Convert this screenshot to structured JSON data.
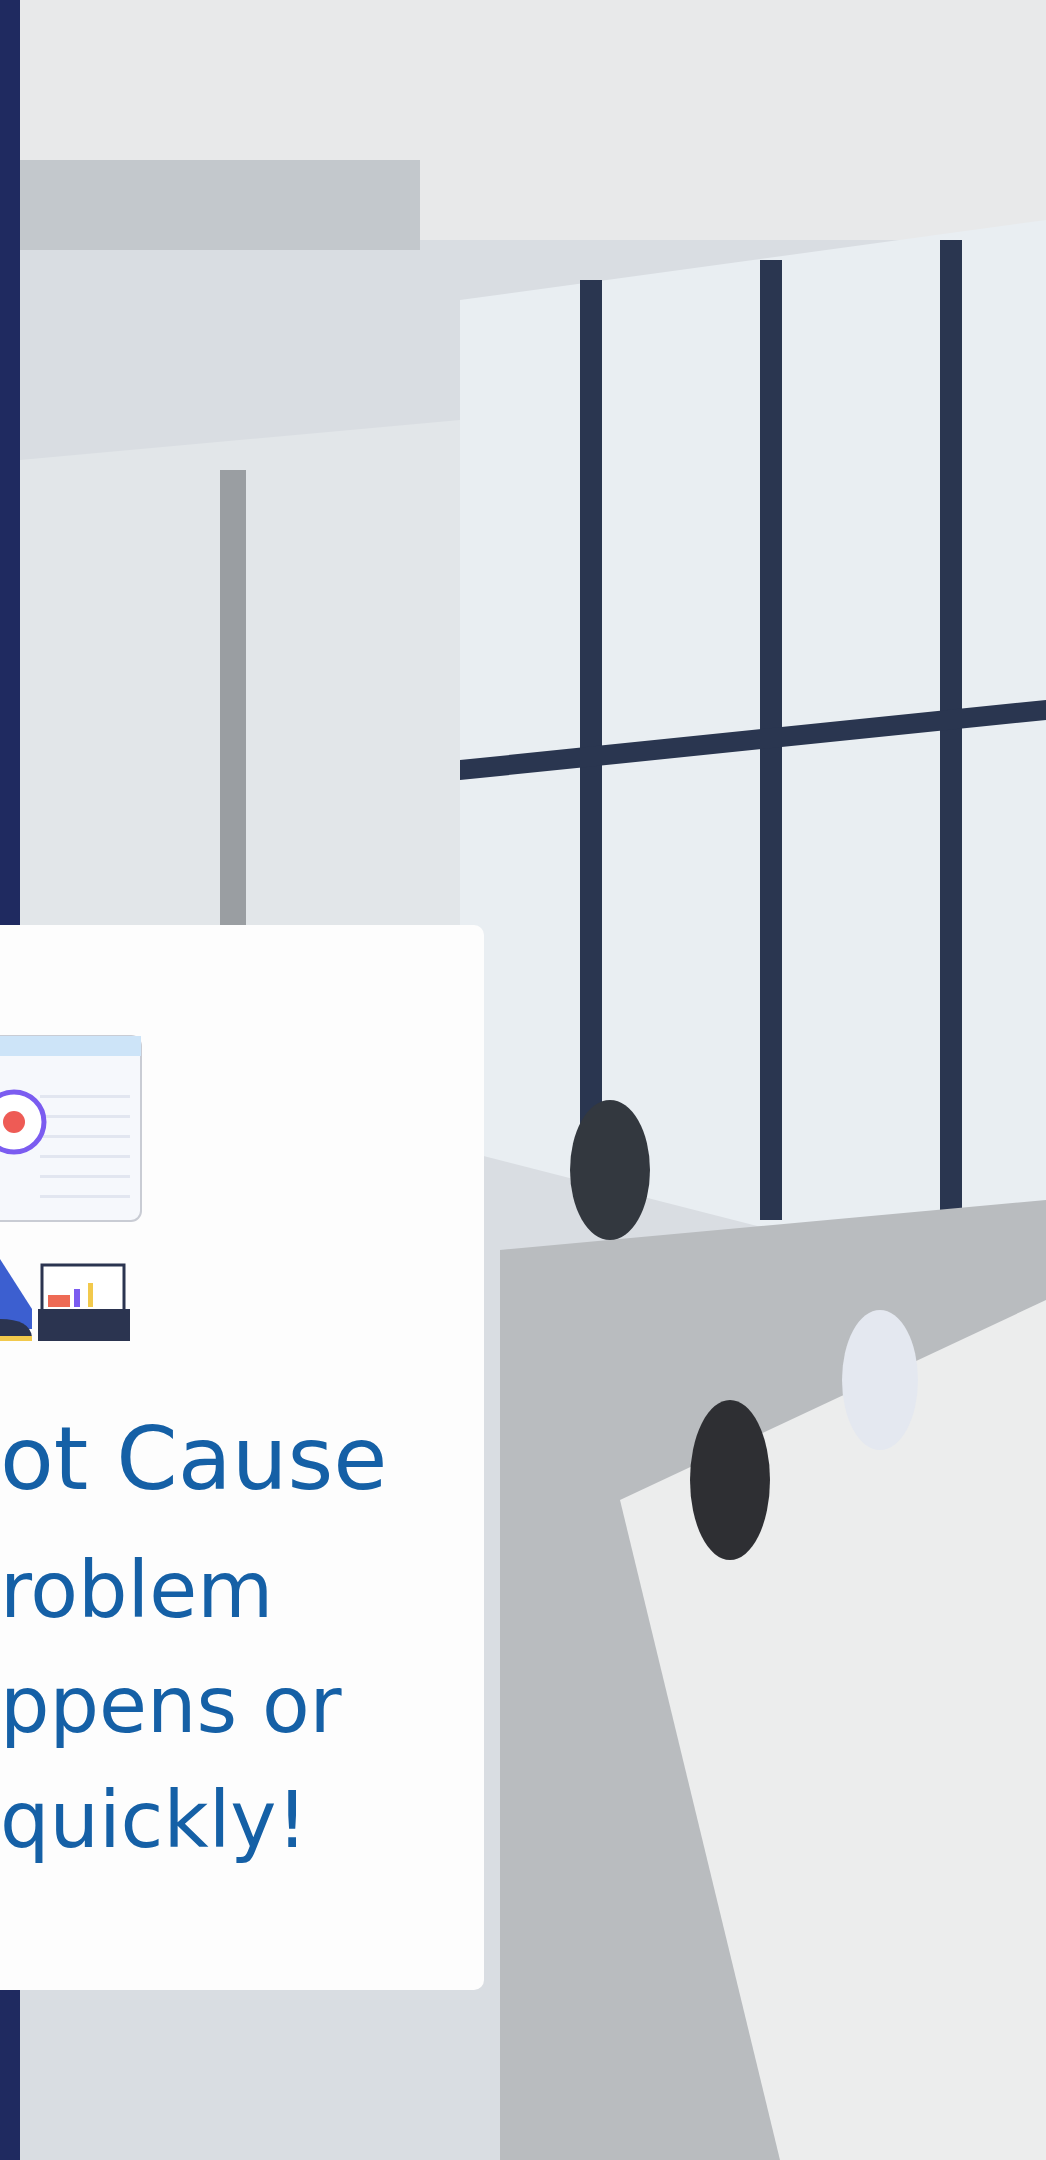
{
  "card": {
    "title": "ot Cause",
    "body_lines": [
      "roblem",
      "ppens or",
      "quickly!"
    ]
  }
}
